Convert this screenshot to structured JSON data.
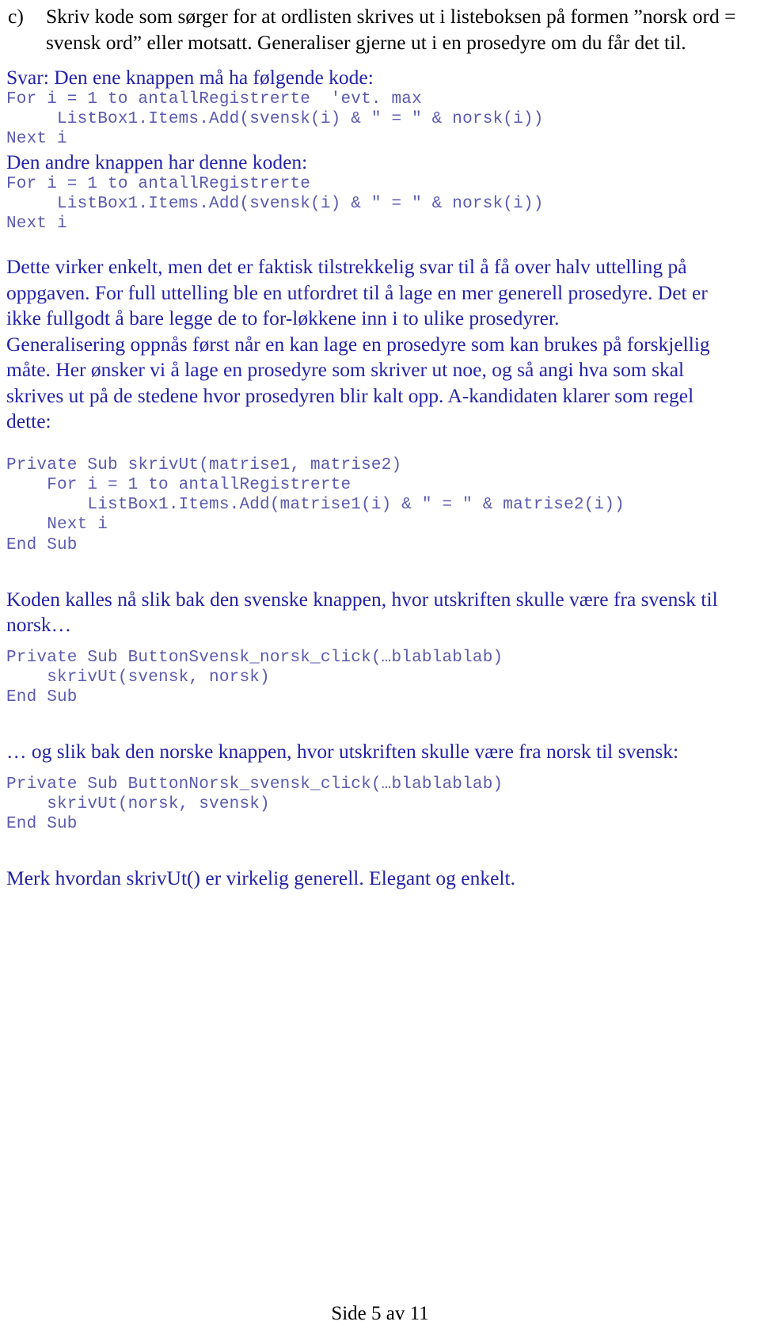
{
  "colors": {
    "prose": "#2323a8",
    "code": "#5a5ab0",
    "black": "#000000",
    "page_background": "#ffffff"
  },
  "question": {
    "marker": "c)",
    "text": "Skriv kode som sørger for at ordlisten skrives ut i listeboksen på formen ”norsk ord = svensk ord” eller motsatt. Generaliser gjerne ut i en prosedyre om du får det til."
  },
  "answer": {
    "lead_1": "Svar: Den ene knappen må ha følgende kode:",
    "code_1": "For i = 1 to antallRegistrerte  'evt. max\n     ListBox1.Items.Add(svensk(i) & \" = \" & norsk(i))\nNext i",
    "lead_2": "Den andre knappen har denne koden:",
    "code_2": "For i = 1 to antallRegistrerte\n     ListBox1.Items.Add(svensk(i) & \" = \" & norsk(i))\nNext i"
  },
  "discussion": {
    "paragraph_1": "Dette virker enkelt, men det er faktisk tilstrekkelig svar til å få over halv uttelling på oppgaven. For full uttelling ble en utfordret til å lage en mer generell prosedyre. Det er ikke fullgodt å bare legge de to for-løkkene inn i to ulike prosedyrer.",
    "paragraph_2": "Generalisering oppnås først når en kan lage en prosedyre som kan brukes på forskjellig måte. Her ønsker vi å lage en prosedyre som skriver ut noe, og så angi hva som skal skrives ut på de stedene hvor prosedyren blir kalt opp. A-kandidaten klarer som regel dette:"
  },
  "procedure": {
    "code": "Private Sub skrivUt(matrise1, matrise2)\n    For i = 1 to antallRegistrerte\n        ListBox1.Items.Add(matrise1(i) & \" = \" & matrise2(i))\n    Next i\nEnd Sub"
  },
  "call_svensk": {
    "intro": "Koden kalles nå slik bak den svenske knappen, hvor utskriften skulle være fra svensk til norsk…",
    "code": "Private Sub ButtonSvensk_norsk_click(…blablablab)\n    skrivUt(svensk, norsk)\nEnd Sub"
  },
  "call_norsk": {
    "intro": "… og slik bak den norske knappen, hvor utskriften skulle være fra norsk til svensk:",
    "code": "Private Sub ButtonNorsk_svensk_click(…blablablab)\n    skrivUt(norsk, svensk)\nEnd Sub"
  },
  "closing": {
    "text": "Merk hvordan skrivUt() er virkelig generell. Elegant og enkelt."
  },
  "footer": {
    "page_label": "Side 5 av 11"
  }
}
